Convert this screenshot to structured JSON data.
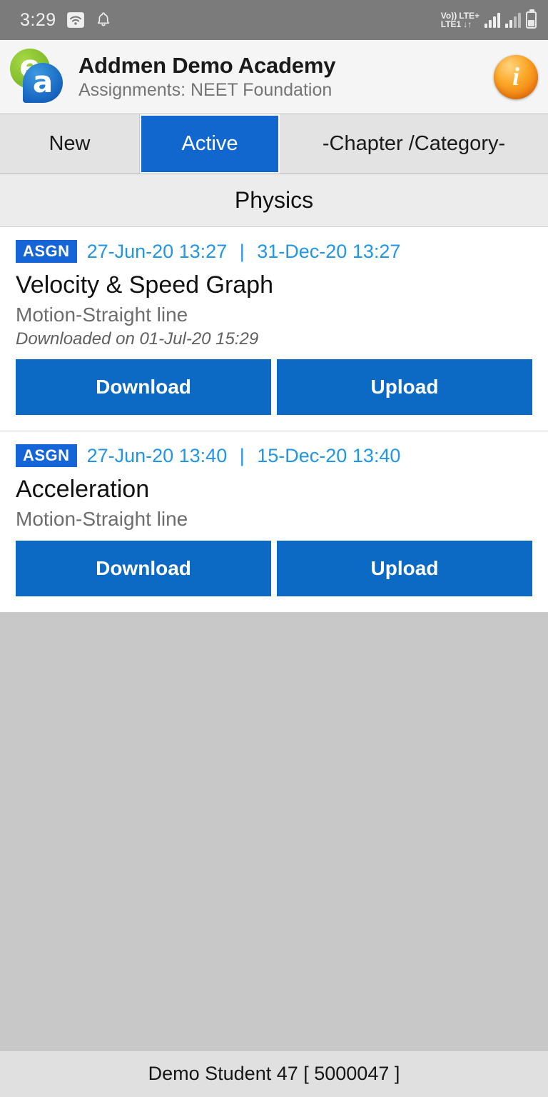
{
  "status_bar": {
    "time": "3:29",
    "wifi_icon": "wifi-icon",
    "notification_icon": "bell-icon",
    "volte_line1": "Vo))",
    "volte_line2": "LTE1",
    "network_label": "LTE+",
    "data_arrows": "↓↑",
    "battery_icon": "battery-icon"
  },
  "header": {
    "logo_letter_1": "e",
    "logo_letter_2": "a",
    "title": "Addmen Demo Academy",
    "subtitle": "Assignments: NEET Foundation",
    "info_icon_glyph": "i",
    "info_icon_name": "info-icon"
  },
  "tabs": [
    {
      "label": "New",
      "selected": false
    },
    {
      "label": "Active",
      "selected": true
    },
    {
      "label": "-Chapter /Category-",
      "selected": false
    }
  ],
  "section": {
    "title": "Physics"
  },
  "assignments": [
    {
      "badge": "ASGN",
      "date_start": "27-Jun-20 13:27",
      "separator": "|",
      "date_end": "31-Dec-20 13:27",
      "title": "Velocity & Speed Graph",
      "chapter": "Motion-Straight line",
      "note": "Downloaded on 01-Jul-20 15:29",
      "download_label": "Download",
      "upload_label": "Upload"
    },
    {
      "badge": "ASGN",
      "date_start": "27-Jun-20 13:40",
      "separator": "|",
      "date_end": "15-Dec-20 13:40",
      "title": "Acceleration",
      "chapter": "Motion-Straight line",
      "note": "",
      "download_label": "Download",
      "upload_label": "Upload"
    }
  ],
  "footer": {
    "user": "Demo Student 47 [ 5000047 ]"
  },
  "colors": {
    "accent_blue": "#0d6ac4",
    "tab_active_blue": "#1267ce",
    "badge_blue": "#1565d8",
    "date_blue": "#2196e8",
    "status_bar_gray": "#7b7b7b",
    "body_gray": "#c8c8c8",
    "footer_gray": "#e0e0e0"
  }
}
